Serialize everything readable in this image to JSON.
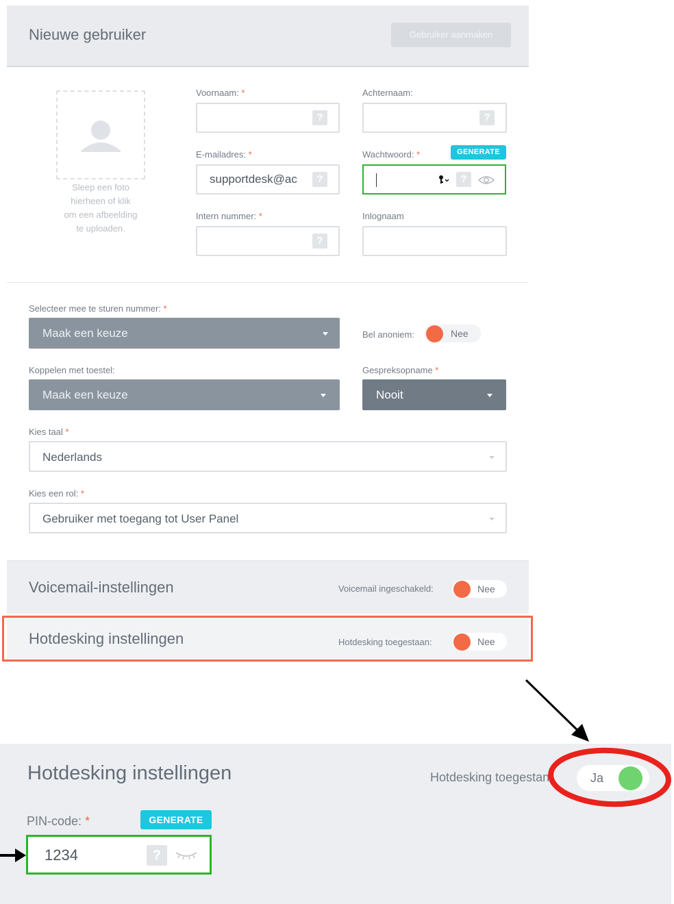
{
  "header": {
    "title": "Nieuwe gebruiker",
    "create_button": "Gebruiker aanmaken"
  },
  "photo": {
    "hint_lines": [
      "Sleep een foto",
      "hierheen of klik",
      "om een afbeelding",
      "te uploaden."
    ]
  },
  "fields": {
    "first_name": {
      "label": "Voornaam:",
      "required": "*",
      "value": ""
    },
    "last_name": {
      "label": "Achternaam:",
      "value": ""
    },
    "email": {
      "label": "E-mailadres:",
      "required": "*",
      "value": "supportdesk@ac"
    },
    "password": {
      "label": "Wachtwoord:",
      "required": "*",
      "generate": "GENERATE",
      "value": ""
    },
    "internal_number": {
      "label": "Intern nummer:",
      "required": "*",
      "value": ""
    },
    "login_name": {
      "label": "Inlognaam",
      "value": ""
    },
    "help_glyph": "?"
  },
  "selects": {
    "send_number": {
      "label": "Selecteer mee te sturen nummer:",
      "required": "*",
      "value": "Maak een keuze"
    },
    "anonymous": {
      "label": "Bel anoniem:",
      "value": "Nee"
    },
    "device": {
      "label": "Koppelen met toestel:",
      "value": "Maak een keuze"
    },
    "recording": {
      "label": "Gespreksopname",
      "required": "*",
      "value": "Nooit"
    },
    "language": {
      "label": "Kies taal",
      "required": "*",
      "value": "Nederlands"
    },
    "role": {
      "label": "Kies een rol:",
      "required": "*",
      "value": "Gebruiker met toegang tot User Panel"
    }
  },
  "voicemail": {
    "title": "Voicemail-instellingen",
    "toggle_label": "Voicemail ingeschakeld:",
    "toggle_value": "Nee"
  },
  "hotdesking": {
    "title": "Hotdesking instellingen",
    "toggle_label": "Hotdesking toegestaan:",
    "toggle_value": "Nee"
  },
  "zoom": {
    "title": "Hotdesking instellingen",
    "toggle_label_visible": "Hotdesking toegesta",
    "toggle_label_tail": "n:",
    "toggle_value": "Ja",
    "pin_label": "PIN-code:",
    "pin_required": "*",
    "generate": "GENERATE",
    "pin_value": "1234"
  },
  "colors": {
    "accent_cyan": "#1ec6de",
    "toggle_off": "#f26a46",
    "toggle_on": "#6fd46f",
    "highlight_green": "#2db42d",
    "highlight_red": "#f06a4f",
    "circle_red": "#e8221c"
  }
}
